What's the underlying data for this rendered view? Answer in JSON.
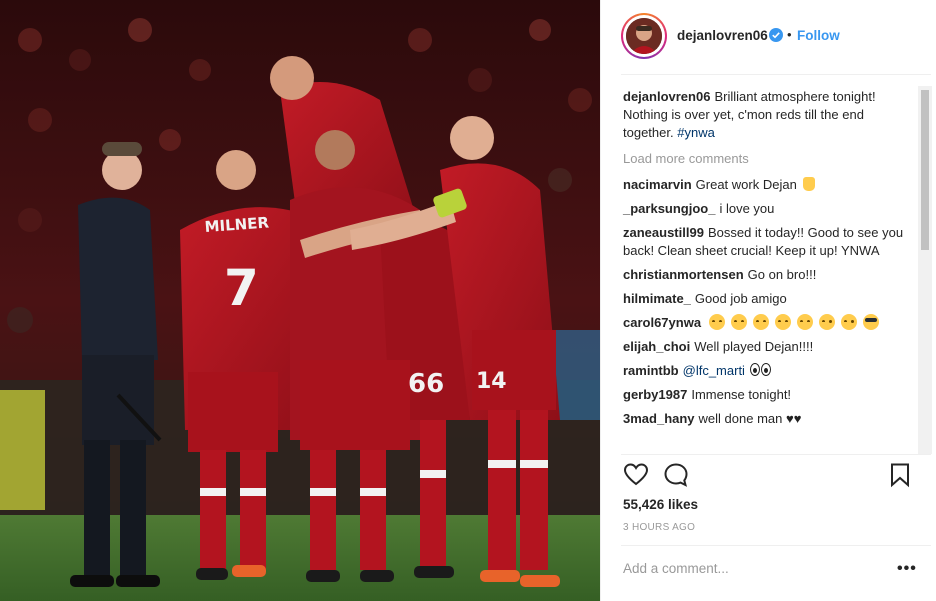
{
  "post": {
    "photo_alt": "Liverpool players celebrating a goal in a huddle on the pitch, referee watching on the left",
    "shirt_names": {
      "left_player": "MILNER",
      "left_number": "7",
      "right_number": "66",
      "right_sleeve": "14"
    }
  },
  "header": {
    "username": "dejanlovren06",
    "dot": "•",
    "follow_label": "Follow"
  },
  "caption": {
    "user": "dejanlovren06",
    "text": "Brilliant atmosphere tonight! Nothing is over yet, c'mon reds till the end together.",
    "hashtag": "#ynwa"
  },
  "load_more": "Load more comments",
  "comments": [
    {
      "user": "nacimarvin",
      "text": "Great work Dejan"
    },
    {
      "user": "_parksungjoo_",
      "text": "i love you"
    },
    {
      "user": "zaneaustill99",
      "text": "Bossed it today!! Good to see you back! Clean sheet crucial! Keep it up! YNWA"
    },
    {
      "user": "christianmortensen",
      "text": "Go on bro!!!"
    },
    {
      "user": "hilmimate_",
      "text": "Good job amigo"
    },
    {
      "user": "carol67ynwa",
      "text": ""
    },
    {
      "user": "elijah_choi",
      "text": "Well played Dejan!!!!"
    },
    {
      "user": "ramintbb",
      "text": "@lfc_marti"
    },
    {
      "user": "gerby1987",
      "text": "Immense tonight!"
    },
    {
      "user": "3mad_hany",
      "text": "well done man"
    }
  ],
  "likes": "55,426 likes",
  "time": "3 HOURS AGO",
  "add_comment_placeholder": "Add a comment...",
  "more_label": "•••",
  "colors": {
    "follow": "#3897f0",
    "kit_red": "#b3141f",
    "pitch": "#3e6b2a"
  }
}
